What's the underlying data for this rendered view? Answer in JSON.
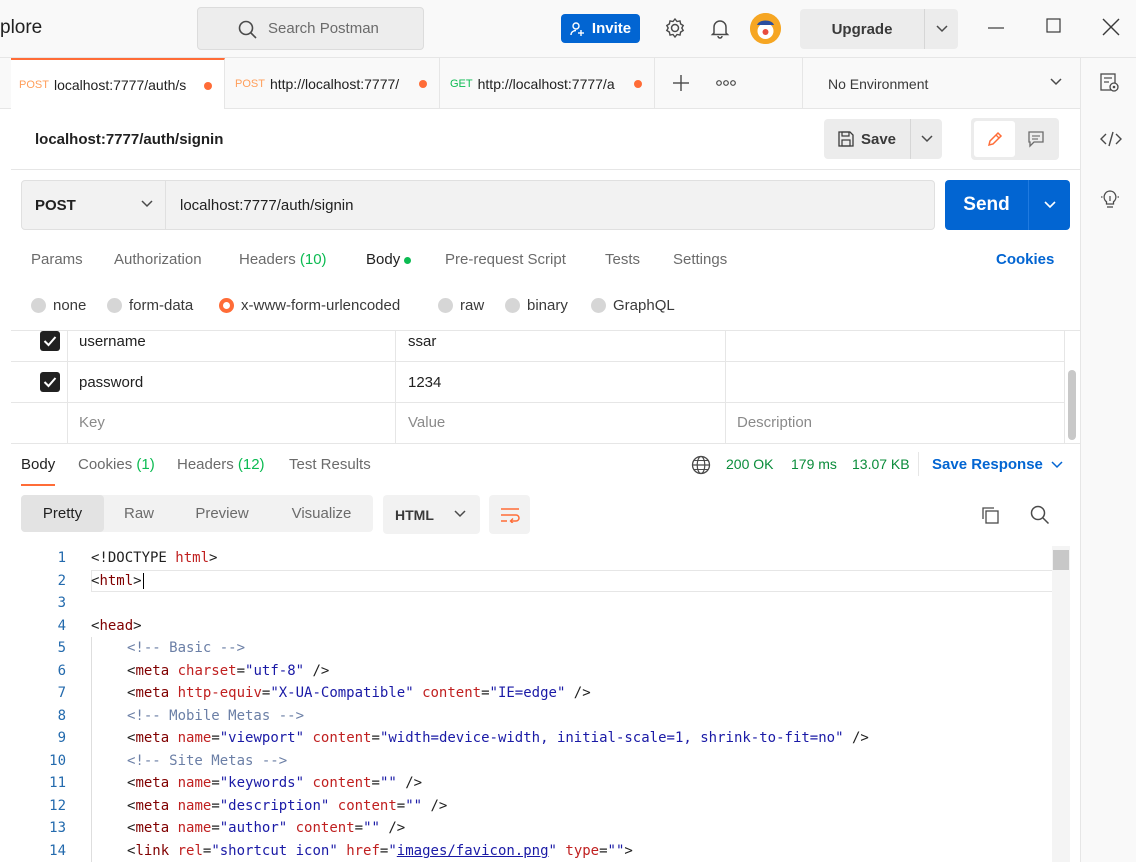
{
  "titlebar": {
    "title": "plore",
    "search_placeholder": "Search Postman",
    "invite_label": "Invite",
    "upgrade_label": "Upgrade"
  },
  "tabs": [
    {
      "method": "POST",
      "label": "localhost:7777/auth/s",
      "active": true
    },
    {
      "method": "POST",
      "label": "http://localhost:7777/",
      "active": false
    },
    {
      "method": "GET",
      "label": "http://localhost:7777/a",
      "active": false
    }
  ],
  "environment": "No Environment",
  "request": {
    "title": "localhost:7777/auth/signin",
    "save_label": "Save",
    "method": "POST",
    "url": "localhost:7777/auth/signin",
    "send_label": "Send"
  },
  "request_tabs": {
    "params": "Params",
    "authorization": "Authorization",
    "headers": "Headers",
    "headers_count": "(10)",
    "body": "Body",
    "prerequest": "Pre-request Script",
    "tests": "Tests",
    "settings": "Settings",
    "cookies": "Cookies"
  },
  "body_types": {
    "none": "none",
    "form_data": "form-data",
    "urlencoded": "x-www-form-urlencoded",
    "raw": "raw",
    "binary": "binary",
    "graphql": "GraphQL",
    "selected": "x-www-form-urlencoded"
  },
  "params": [
    {
      "key": "username",
      "value": "ssar",
      "checked": true
    },
    {
      "key": "password",
      "value": "1234",
      "checked": true
    }
  ],
  "params_placeholder": {
    "key": "Key",
    "value": "Value",
    "description": "Description"
  },
  "response": {
    "tabs": {
      "body": "Body",
      "cookies": "Cookies",
      "cookies_count": "(1)",
      "headers": "Headers",
      "headers_count": "(12)",
      "test_results": "Test Results"
    },
    "status": "200 OK",
    "time": "179 ms",
    "size": "13.07 KB",
    "save_response": "Save Response",
    "views": {
      "pretty": "Pretty",
      "raw": "Raw",
      "preview": "Preview",
      "visualize": "Visualize"
    },
    "format": "HTML"
  },
  "code_lines": [
    "1",
    "2",
    "3",
    "4",
    "5",
    "6",
    "7",
    "8",
    "9",
    "10",
    "11",
    "12",
    "13",
    "14"
  ],
  "code": {
    "l1a": "<!DOCTYPE ",
    "l1b": "html",
    "l1c": ">",
    "l2a": "<",
    "l2b": "html",
    "l2c": ">",
    "l4a": "<",
    "l4b": "head",
    "l4c": ">",
    "l5": "<!-- Basic -->",
    "l6a": "<",
    "l6b": "meta",
    "l6c": "charset",
    "l6d": "\"utf-8\"",
    "l6e": " />",
    "l7a": "<",
    "l7b": "meta",
    "l7c": "http-equiv",
    "l7d": "\"X-UA-Compatible\"",
    "l7e": "content",
    "l7f": "\"IE=edge\"",
    "l7g": " />",
    "l8": "<!-- Mobile Metas -->",
    "l9a": "<",
    "l9b": "meta",
    "l9c": "name",
    "l9d": "\"viewport\"",
    "l9e": "content",
    "l9f": "\"width=device-width, initial-scale=1, shrink-to-fit=no\"",
    "l9g": " />",
    "l10": "<!-- Site Metas -->",
    "l11a": "<",
    "l11b": "meta",
    "l11c": "name",
    "l11d": "\"keywords\"",
    "l11e": "content",
    "l11f": "\"\"",
    "l11g": " />",
    "l12a": "<",
    "l12b": "meta",
    "l12c": "name",
    "l12d": "\"description\"",
    "l12e": "content",
    "l12f": "\"\"",
    "l12g": " />",
    "l13a": "<",
    "l13b": "meta",
    "l13c": "name",
    "l13d": "\"author\"",
    "l13e": "content",
    "l13f": "\"\"",
    "l13g": " />",
    "l14a": "<",
    "l14b": "link",
    "l14c": "rel",
    "l14d": "\"shortcut icon\"",
    "l14e": "href",
    "l14f": "\"",
    "l14g": "images/favicon.png",
    "l14h": "\"",
    "l14i": "type",
    "l14j": "\"\"",
    "l14k": ">"
  },
  "colors": {
    "accent": "#ff6c37",
    "primary": "#0265d2",
    "success": "#0cbb52"
  }
}
